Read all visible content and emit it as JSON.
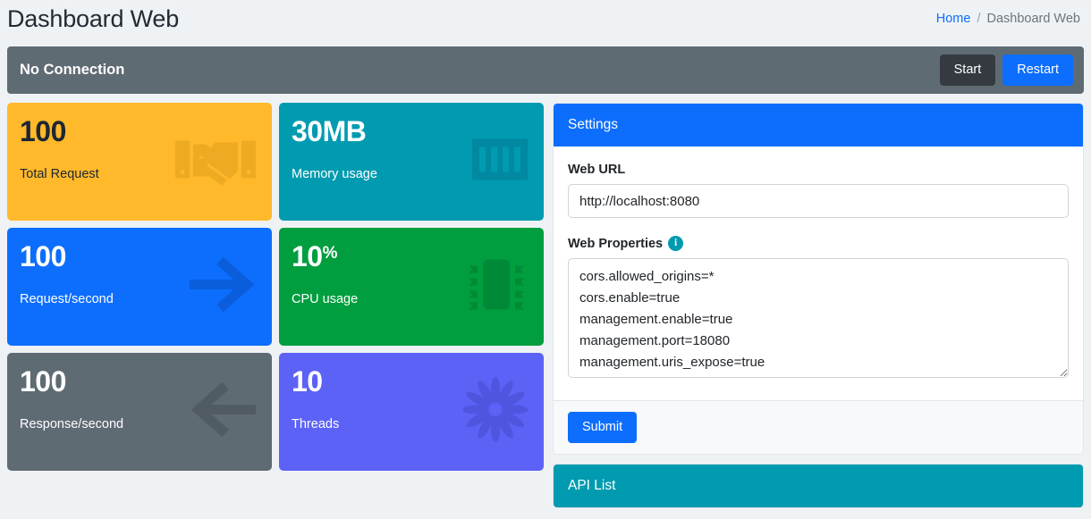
{
  "header": {
    "title": "Dashboard Web",
    "breadcrumb": {
      "home": "Home",
      "separator": "/",
      "current": "Dashboard Web"
    }
  },
  "status_bar": {
    "status_text": "No Connection",
    "start_label": "Start",
    "restart_label": "Restart"
  },
  "stat_cards": [
    {
      "value": "100",
      "suffix": "",
      "label": "Total Request",
      "icon": "handshake-icon",
      "color": "#ffb92b"
    },
    {
      "value": "30MB",
      "suffix": "",
      "label": "Memory usage",
      "icon": "memory-chip-icon",
      "color": "#009bb0"
    },
    {
      "value": "100",
      "suffix": "",
      "label": "Request/second",
      "icon": "arrow-right-icon",
      "color": "#0d6efd"
    },
    {
      "value": "10",
      "suffix": "%",
      "label": "CPU usage",
      "icon": "cpu-chip-icon",
      "color": "#009e3f"
    },
    {
      "value": "100",
      "suffix": "",
      "label": "Response/second",
      "icon": "arrow-left-icon",
      "color": "#5f6b73"
    },
    {
      "value": "10",
      "suffix": "",
      "label": "Threads",
      "icon": "spinner-icon",
      "color": "#5c62f5"
    }
  ],
  "settings_panel": {
    "title": "Settings",
    "web_url_label": "Web URL",
    "web_url_value": "http://localhost:8080",
    "web_url_placeholder": "http://localhost:8080",
    "web_properties_label": "Web Properties",
    "web_properties_info_icon": "info-icon",
    "web_properties_value": "cors.allowed_origins=*\ncors.enable=true\nmanagement.enable=true\nmanagement.port=18080\nmanagement.uris_expose=true",
    "web_properties_placeholder": "",
    "submit_label": "Submit"
  },
  "api_list_panel": {
    "title": "API List"
  },
  "colors": {
    "page_background": "#eff2f5",
    "accent_primary": "#0d6efd",
    "accent_teal": "#009bb0",
    "accent_amber": "#ffb92b",
    "accent_green": "#009e3f",
    "accent_gray": "#5f6b73",
    "accent_purple": "#5c62f5",
    "dark": "#343a40"
  }
}
